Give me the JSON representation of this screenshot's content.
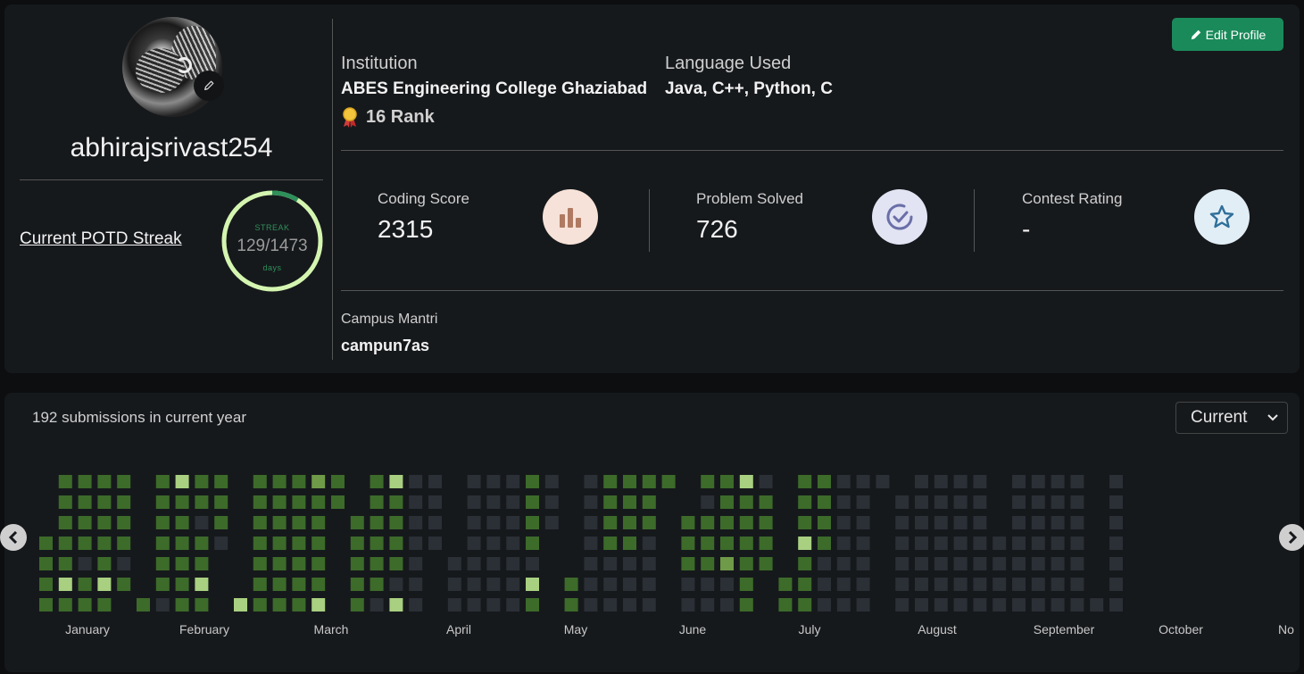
{
  "profile": {
    "username": "abhirajsrivast254",
    "edit_profile_label": "Edit Profile",
    "streak": {
      "link_label": "Current POTD Streak",
      "caption_top": "STREAK",
      "value": "129/1473",
      "caption_bottom": "days",
      "current": 129,
      "max": 1473,
      "ring_color": "#d4f5b0",
      "progress_color": "#2f8f5a"
    },
    "institution_label": "Institution",
    "institution": "ABES Engineering College Ghaziabad",
    "rank": "16 Rank",
    "language_label": "Language Used",
    "languages": "Java, C++, Python, C",
    "stats": [
      {
        "label": "Coding Score",
        "value": "2315",
        "icon": "bar-chart-icon",
        "icon_bg": "#f6e2d8",
        "icon_color": "#b07a62"
      },
      {
        "label": "Problem Solved",
        "value": "726",
        "icon": "check-circle-icon",
        "icon_bg": "#e2e4f3",
        "icon_color": "#6a6fa8"
      },
      {
        "label": "Contest Rating",
        "value": "-",
        "icon": "star-icon",
        "icon_bg": "#e2eef6",
        "icon_color": "#2f6f9a"
      }
    ],
    "campus_label": "Campus Mantri",
    "campus_value": "campun7as"
  },
  "heatmap": {
    "submissions_text": "192 submissions in current year",
    "year_select": "Current",
    "months": [
      "January",
      "February",
      "March",
      "April",
      "May",
      "June",
      "July",
      "August",
      "September",
      "October",
      "No"
    ],
    "colors": {
      "0": "#2b2f36",
      "1": "#3d6b2a",
      "2": "#6f9a48",
      "3": "#a8d080"
    },
    "weeks": [
      [
        null,
        null,
        null,
        1,
        1,
        1,
        1
      ],
      [
        1,
        1,
        1,
        1,
        1,
        3,
        1
      ],
      [
        1,
        1,
        1,
        1,
        0,
        1,
        1
      ],
      [
        1,
        1,
        1,
        1,
        1,
        3,
        1
      ],
      [
        1,
        1,
        1,
        1,
        0,
        1,
        null
      ],
      [
        null,
        null,
        null,
        null,
        null,
        null,
        1
      ],
      [
        1,
        1,
        1,
        1,
        1,
        1,
        0
      ],
      [
        3,
        1,
        1,
        1,
        1,
        1,
        1
      ],
      [
        1,
        1,
        0,
        1,
        1,
        3,
        1
      ],
      [
        1,
        1,
        1,
        0,
        null,
        null,
        null
      ],
      [
        null,
        null,
        null,
        null,
        null,
        null,
        3
      ],
      [
        1,
        1,
        1,
        1,
        1,
        1,
        1
      ],
      [
        1,
        1,
        1,
        1,
        1,
        1,
        1
      ],
      [
        1,
        1,
        1,
        1,
        1,
        1,
        1
      ],
      [
        2,
        1,
        1,
        1,
        1,
        1,
        3
      ],
      [
        1,
        1,
        null,
        null,
        null,
        null,
        null
      ],
      [
        null,
        null,
        1,
        1,
        1,
        1,
        1
      ],
      [
        1,
        1,
        1,
        1,
        1,
        1,
        0
      ],
      [
        3,
        1,
        1,
        1,
        1,
        0,
        3
      ],
      [
        0,
        0,
        0,
        0,
        0,
        0,
        0
      ],
      [
        0,
        0,
        0,
        0,
        null,
        null,
        null
      ],
      [
        null,
        null,
        null,
        null,
        0,
        0,
        0
      ],
      [
        0,
        0,
        0,
        0,
        0,
        0,
        0
      ],
      [
        0,
        0,
        0,
        0,
        0,
        0,
        0
      ],
      [
        0,
        0,
        0,
        0,
        0,
        0,
        0
      ],
      [
        1,
        1,
        1,
        1,
        0,
        3,
        1
      ],
      [
        0,
        0,
        0,
        null,
        null,
        null,
        null
      ],
      [
        null,
        null,
        null,
        null,
        null,
        1,
        1
      ],
      [
        0,
        0,
        0,
        0,
        0,
        0,
        0
      ],
      [
        1,
        1,
        1,
        1,
        0,
        0,
        0
      ],
      [
        1,
        1,
        1,
        1,
        0,
        0,
        0
      ],
      [
        1,
        1,
        1,
        0,
        0,
        0,
        0
      ],
      [
        1,
        null,
        null,
        null,
        null,
        null,
        null
      ],
      [
        null,
        null,
        1,
        1,
        1,
        0,
        0
      ],
      [
        1,
        0,
        1,
        1,
        1,
        0,
        0
      ],
      [
        1,
        1,
        1,
        1,
        2,
        0,
        0
      ],
      [
        3,
        1,
        1,
        1,
        1,
        1,
        1
      ],
      [
        0,
        1,
        1,
        1,
        1,
        null,
        null
      ],
      [
        null,
        null,
        null,
        null,
        null,
        1,
        1
      ],
      [
        1,
        1,
        1,
        3,
        1,
        1,
        1
      ],
      [
        1,
        1,
        1,
        1,
        0,
        0,
        0
      ],
      [
        0,
        0,
        0,
        0,
        0,
        0,
        0
      ],
      [
        0,
        0,
        0,
        0,
        0,
        0,
        0
      ],
      [
        0,
        null,
        null,
        null,
        null,
        null,
        null
      ],
      [
        null,
        0,
        0,
        0,
        0,
        0,
        0
      ],
      [
        0,
        0,
        0,
        0,
        0,
        0,
        0
      ],
      [
        0,
        0,
        0,
        0,
        0,
        0,
        0
      ],
      [
        0,
        0,
        0,
        0,
        0,
        0,
        0
      ],
      [
        0,
        0,
        0,
        0,
        0,
        0,
        0
      ],
      [
        null,
        null,
        null,
        0,
        0,
        0,
        0
      ],
      [
        0,
        0,
        0,
        0,
        0,
        0,
        0
      ],
      [
        0,
        0,
        0,
        0,
        0,
        0,
        0
      ],
      [
        0,
        0,
        0,
        0,
        0,
        0,
        0
      ],
      [
        0,
        0,
        0,
        0,
        0,
        0,
        0
      ],
      [
        null,
        null,
        null,
        null,
        null,
        null,
        0
      ],
      [
        0,
        0,
        0,
        0,
        0,
        0,
        0
      ]
    ]
  }
}
